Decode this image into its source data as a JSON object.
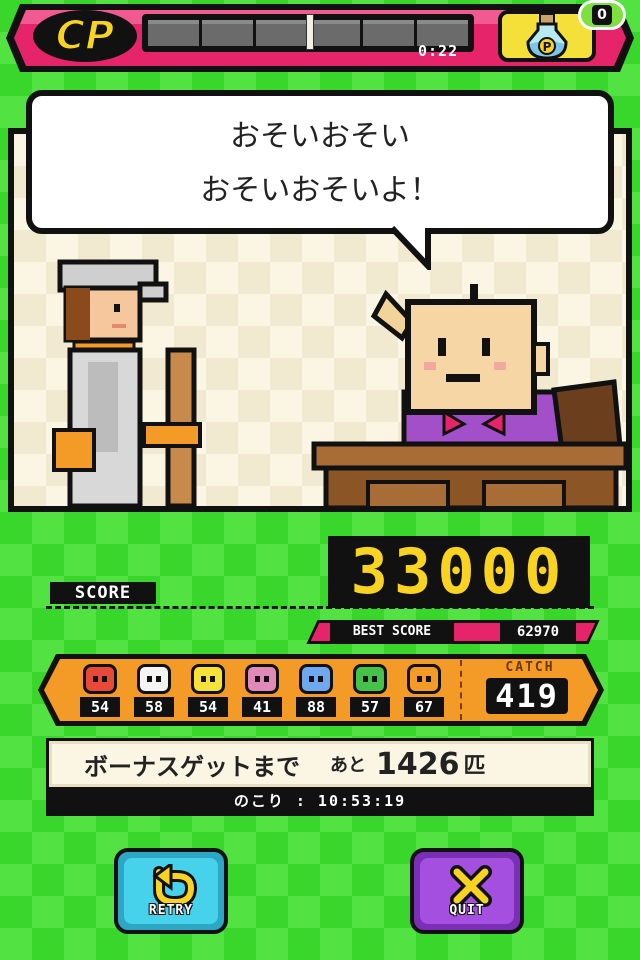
{
  "topbar": {
    "logo": "CP",
    "timer": "0:22",
    "potion_icon": "potion-p-icon",
    "potion_count": "0",
    "potion_letter": "P"
  },
  "dialog": {
    "line1": "おそいおそい",
    "line2": "おそいおそいよ！"
  },
  "score": {
    "label": "SCORE",
    "value": "33000",
    "best_label": "BEST SCORE",
    "best_value": "62970"
  },
  "catch": {
    "monsters": [
      {
        "icon": "red-monster-icon",
        "count": "54",
        "color": "#e84a3a"
      },
      {
        "icon": "white-monster-icon",
        "count": "58",
        "color": "#f4f4f4"
      },
      {
        "icon": "yellow-monster-icon",
        "count": "54",
        "color": "#f7e23a"
      },
      {
        "icon": "pink-monster-icon",
        "count": "41",
        "color": "#e08ab8"
      },
      {
        "icon": "blue-monster-icon",
        "count": "88",
        "color": "#6fa8ef"
      },
      {
        "icon": "green-monster-icon",
        "count": "57",
        "color": "#45c24a"
      },
      {
        "icon": "orange-monster-icon",
        "count": "67",
        "color": "#f49a26"
      }
    ],
    "label": "CATCH",
    "total": "419"
  },
  "bonus": {
    "title": "ボーナスゲットまで",
    "ato": "あと",
    "count": "1426",
    "unit": "匹",
    "remaining": "のこり : 10:53:19"
  },
  "buttons": {
    "retry": "RETRY",
    "quit": "QUIT"
  },
  "colors": {
    "accent_pink": "#e6246a",
    "digit_yellow": "#f8d322",
    "panel_orange": "#f49a26",
    "bg_green": "#39d62b"
  }
}
